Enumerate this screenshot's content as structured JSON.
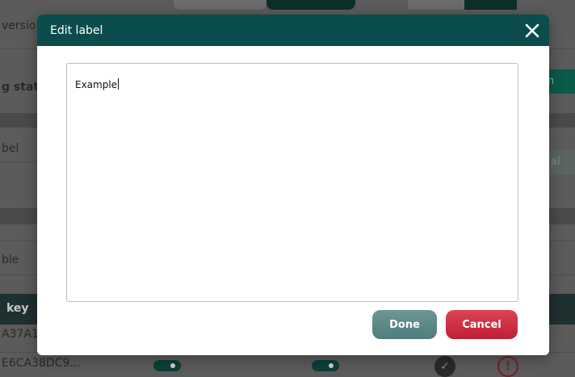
{
  "background": {
    "row_labels": [
      "versio",
      "g statu",
      "bel",
      "ble"
    ],
    "table_header": "key",
    "table_rows": [
      "A37A1",
      "E6CA38DC9..."
    ],
    "right_fragments": [
      "n",
      "al"
    ]
  },
  "dialog": {
    "title": "Edit label",
    "close_icon": "close-icon",
    "textarea_value": "Example",
    "done_label": "Done",
    "cancel_label": "Cancel"
  },
  "colors": {
    "header": "#0b4d4c",
    "done": "#5a8888",
    "cancel": "#c82a3e"
  }
}
